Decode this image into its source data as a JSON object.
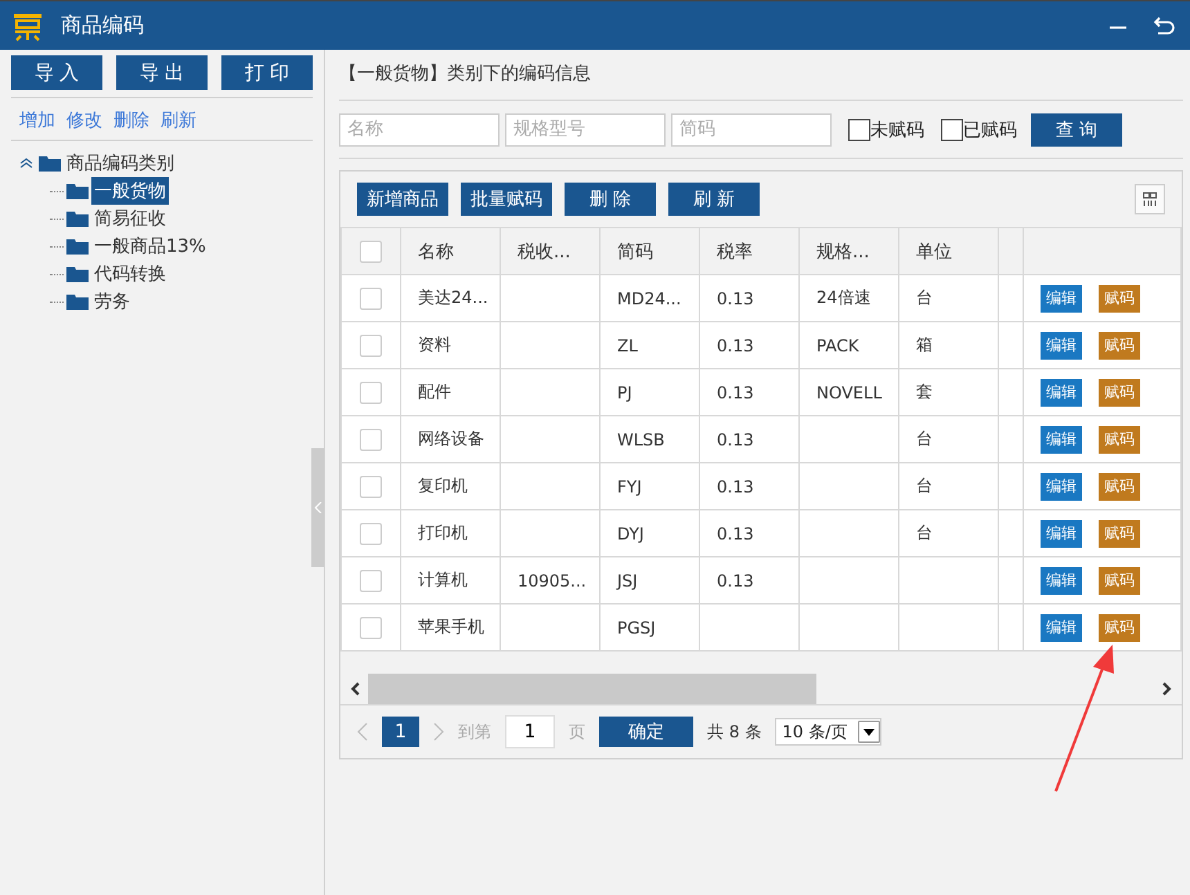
{
  "window": {
    "title": "商品编码"
  },
  "left_buttons": [
    "导 入",
    "导 出",
    "打 印"
  ],
  "left_links": [
    "增加",
    "修改",
    "删除",
    "刷新"
  ],
  "tree": [
    {
      "label": "商品编码类别",
      "expanded": true,
      "selected": false,
      "children": [
        {
          "label": "一般货物",
          "selected": true
        },
        {
          "label": "简易征收",
          "selected": false
        },
        {
          "label": "一般商品13%",
          "selected": false
        },
        {
          "label": "代码转换",
          "selected": false
        },
        {
          "label": "劳务",
          "selected": false
        }
      ]
    }
  ],
  "heading": "【一般货物】类别下的编码信息",
  "filters": {
    "fields": [
      {
        "placeholder": "名称"
      },
      {
        "placeholder": "规格型号"
      },
      {
        "placeholder": "简码"
      }
    ],
    "checkboxes": [
      {
        "label": "未赋码",
        "checked": false
      },
      {
        "label": "已赋码",
        "checked": false
      }
    ],
    "query_button": "查 询"
  },
  "toolbar": [
    "新增商品",
    "批量赋码",
    "删 除",
    "刷 新"
  ],
  "table": {
    "select_all_checked": false,
    "columns": [
      "名称",
      "税收...",
      "简码",
      "税率",
      "规格...",
      "单位"
    ],
    "rows": [
      {
        "checked": false,
        "cells": [
          "美达24...",
          "",
          "MD24...",
          "0.13",
          "24倍速",
          "台"
        ],
        "actions": [
          "编辑",
          "赋码"
        ]
      },
      {
        "checked": false,
        "cells": [
          "资料",
          "",
          "ZL",
          "0.13",
          "PACK",
          "箱"
        ],
        "actions": [
          "编辑",
          "赋码"
        ]
      },
      {
        "checked": false,
        "cells": [
          "配件",
          "",
          "PJ",
          "0.13",
          "NOVELL",
          "套"
        ],
        "actions": [
          "编辑",
          "赋码"
        ]
      },
      {
        "checked": false,
        "cells": [
          "网络设备",
          "",
          "WLSB",
          "0.13",
          "",
          "台"
        ],
        "actions": [
          "编辑",
          "赋码"
        ]
      },
      {
        "checked": false,
        "cells": [
          "复印机",
          "",
          "FYJ",
          "0.13",
          "",
          "台"
        ],
        "actions": [
          "编辑",
          "赋码"
        ]
      },
      {
        "checked": false,
        "cells": [
          "打印机",
          "",
          "DYJ",
          "0.13",
          "",
          "台"
        ],
        "actions": [
          "编辑",
          "赋码"
        ]
      },
      {
        "checked": false,
        "cells": [
          "计算机",
          "10905...",
          "JSJ",
          "0.13",
          "",
          ""
        ],
        "actions": [
          "编辑",
          "赋码"
        ]
      },
      {
        "checked": false,
        "cells": [
          "苹果手机",
          "",
          "PGSJ",
          "",
          "",
          ""
        ],
        "actions": [
          "编辑",
          "赋码"
        ]
      }
    ]
  },
  "pagination": {
    "current_page": "1",
    "goto_label": "到第",
    "goto_value": "1",
    "page_unit": "页",
    "confirm": "确定",
    "total": "共 8 条",
    "page_size": "10 条/页"
  }
}
